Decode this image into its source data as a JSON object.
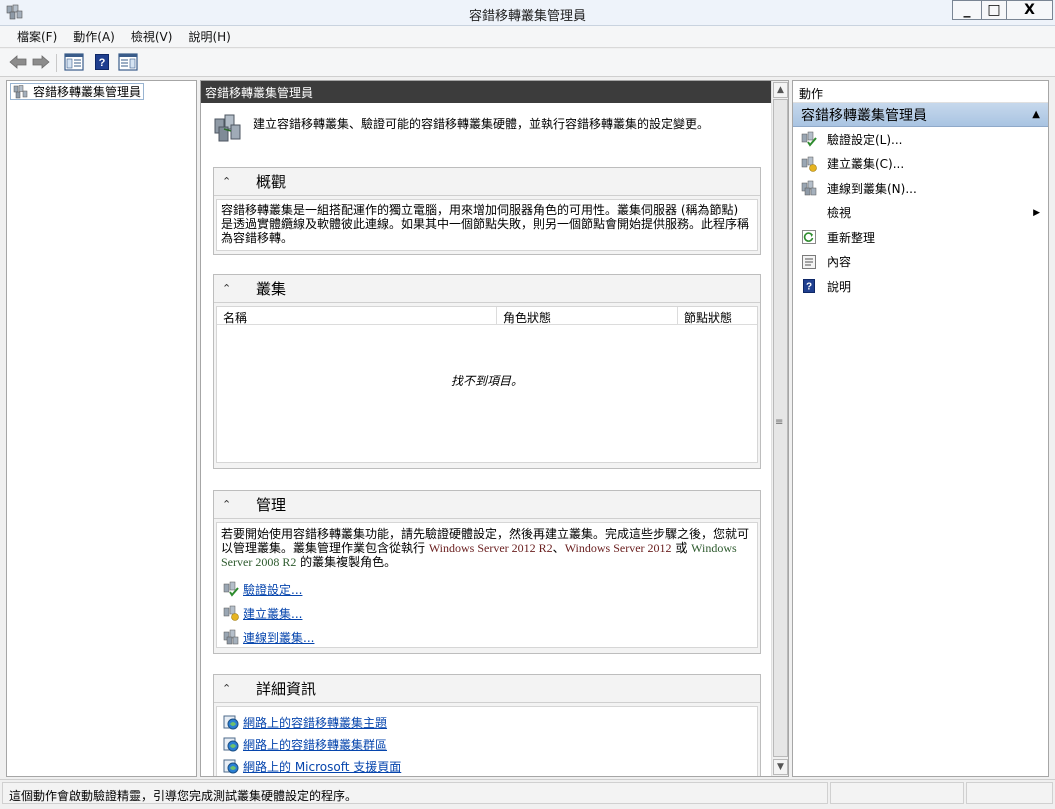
{
  "window": {
    "title": "容錯移轉叢集管理員",
    "minimize": "_",
    "maximize": "□",
    "close": "X"
  },
  "menu": [
    "檔案(F)",
    "動作(A)",
    "檢視(V)",
    "說明(H)"
  ],
  "toolbar": {
    "back_icon": "back-arrow-icon",
    "forward_icon": "forward-arrow-icon",
    "help_glyph": "?"
  },
  "tree": {
    "root_label": "容錯移轉叢集管理員"
  },
  "center": {
    "header": "容錯移轉叢集管理員",
    "intro": "建立容錯移轉叢集、驗證可能的容錯移轉叢集硬體，並執行容錯移轉叢集的設定變更。",
    "overview": {
      "title": "概觀",
      "text": "容錯移轉叢集是一組搭配運作的獨立電腦，用來增加伺服器角色的可用性。叢集伺服器 (稱為節點) 是透過實體纜線及軟體彼此連線。如果其中一個節點失敗，則另一個節點會開始提供服務。此程序稱為容錯移轉。"
    },
    "clusters": {
      "title": "叢集",
      "columns": [
        "名稱",
        "角色狀態",
        "節點狀態"
      ],
      "empty": "找不到項目。"
    },
    "manage": {
      "title": "管理",
      "text_a": "若要開始使用容錯移轉叢集功能，請先驗證硬體設定，然後再建立叢集。完成這些步驟之後，您就可以管理叢集。叢集管理作業包含從執行 ",
      "text_ws1": "Windows Server 2012 R2",
      "text_sep1": "、",
      "text_ws2": "Windows Server 2012",
      "text_sep2": " 或 ",
      "text_ws3": "Windows Server 2008 R2",
      "text_b": " 的叢集複製角色。",
      "links": [
        "驗證設定...",
        "建立叢集...",
        "連線到叢集..."
      ]
    },
    "details": {
      "title": "詳細資訊",
      "links": [
        "網路上的容錯移轉叢集主題",
        "網路上的容錯移轉叢集群區",
        "網路上的 Microsoft 支援頁面"
      ]
    }
  },
  "actions": {
    "header": "動作",
    "group": "容錯移轉叢集管理員",
    "items": [
      "驗證設定(L)...",
      "建立叢集(C)...",
      "連線到叢集(N)...",
      "檢視",
      "重新整理",
      "內容",
      "說明"
    ]
  },
  "status": {
    "text": "這個動作會啟動驗證精靈，引導您完成測試叢集硬體設定的程序。"
  },
  "colors": {
    "header_bg": "#3c3c3c",
    "action_group_bg": "#b3cbe6",
    "link": "#0645ad"
  }
}
